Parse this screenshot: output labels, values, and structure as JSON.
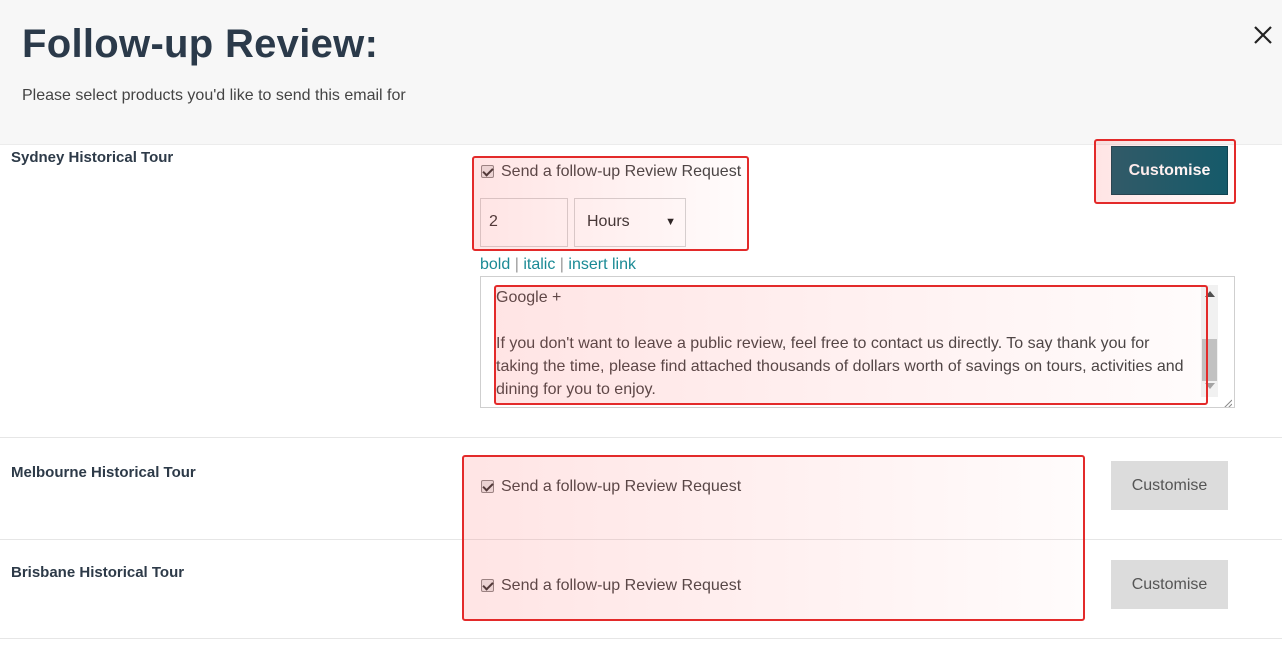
{
  "header": {
    "title": "Follow-up Review:",
    "subtitle": "Please select products you'd like to send this email for",
    "close_icon": "close-icon"
  },
  "colors": {
    "accent_button": "#0f5a6a",
    "link": "#1a8a95",
    "highlight": "#e32a2a"
  },
  "products": [
    {
      "name": "Sydney Historical Tour",
      "checkbox_label": "Send a follow-up Review Request",
      "checked": true,
      "delay_value": "2",
      "delay_unit": "Hours",
      "customise_label": "Customise",
      "format_links": {
        "bold": "bold",
        "separator": "|",
        "italic": "italic",
        "insert_link": "insert link"
      },
      "message_lines": [
        "Google +",
        "If you don't want to leave a public review, feel free to contact us directly. To say thank you for taking the time, please find attached thousands of dollars worth of savings on tours, activities and dining for you to enjoy."
      ]
    },
    {
      "name": "Melbourne Historical Tour",
      "checkbox_label": "Send a follow-up Review Request",
      "checked": true,
      "customise_label": "Customise"
    },
    {
      "name": "Brisbane Historical Tour",
      "checkbox_label": "Send a follow-up Review Request",
      "checked": true,
      "customise_label": "Customise"
    }
  ]
}
